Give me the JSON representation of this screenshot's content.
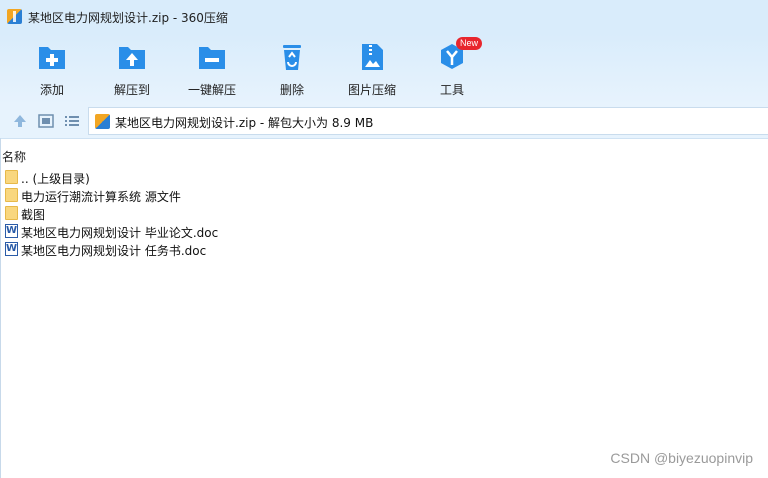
{
  "window": {
    "title": "某地区电力网规划设计.zip - 360压缩"
  },
  "toolbar": {
    "items": [
      {
        "label": "添加",
        "icon": "folder-add-icon"
      },
      {
        "label": "解压到",
        "icon": "folder-extract-icon"
      },
      {
        "label": "一键解压",
        "icon": "folder-one-click-icon"
      },
      {
        "label": "删除",
        "icon": "recycle-delete-icon"
      },
      {
        "label": "图片压缩",
        "icon": "image-compress-icon"
      },
      {
        "label": "工具",
        "icon": "tools-icon",
        "badge": "New"
      }
    ]
  },
  "nav": {
    "path": "某地区电力网规划设计.zip - 解包大小为 8.9 MB"
  },
  "list": {
    "column_name": "名称",
    "items": [
      {
        "name": ".. (上级目录)",
        "type": "folder"
      },
      {
        "name": "电力运行潮流计算系统 源文件",
        "type": "folder"
      },
      {
        "name": "截图",
        "type": "folder"
      },
      {
        "name": "某地区电力网规划设计 毕业论文.doc",
        "type": "word"
      },
      {
        "name": "某地区电力网规划设计 任务书.doc",
        "type": "word"
      }
    ]
  },
  "watermark": "CSDN @biyezuopinvip",
  "colors": {
    "accent": "#2a8ee8",
    "badge": "#e8262d",
    "folder": "#f9d77e"
  }
}
